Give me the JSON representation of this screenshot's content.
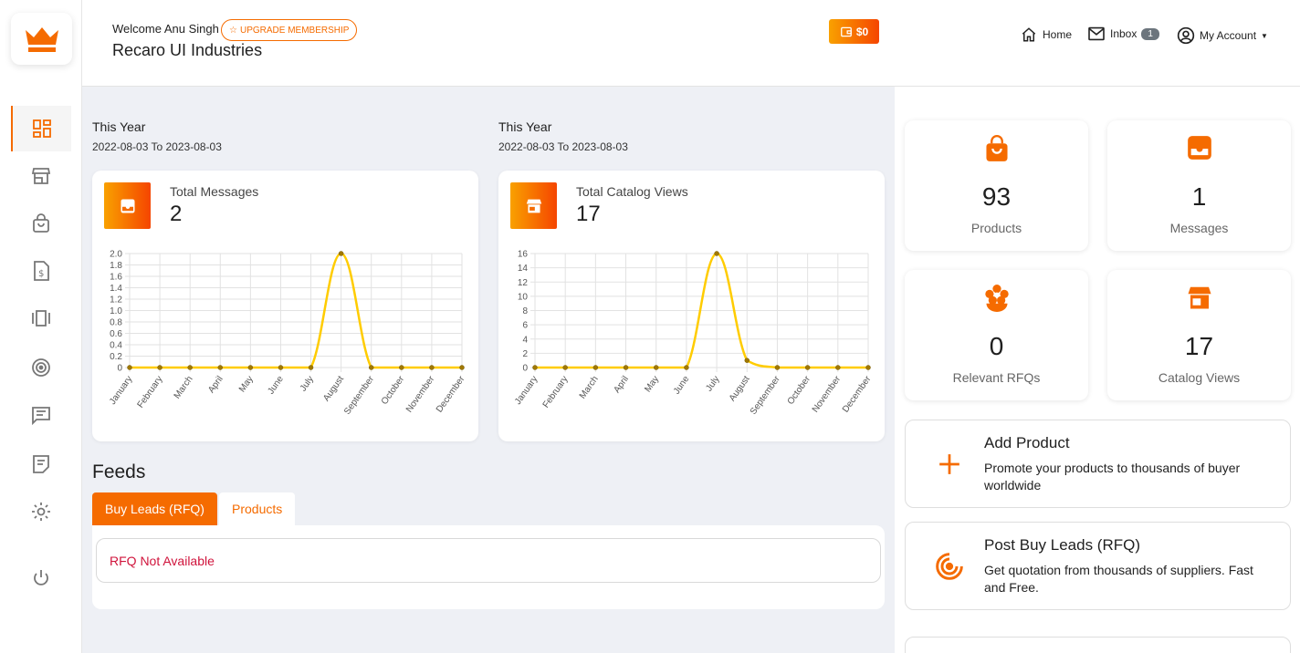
{
  "header": {
    "welcome": "Welcome Anu Singh",
    "upgrade_label": "UPGRADE MEMBERSHIP",
    "company": "Recaro UI Industries",
    "wallet": "$0",
    "home": "Home",
    "inbox": "Inbox",
    "inbox_count": "1",
    "account": "My Account"
  },
  "sidebar": {
    "items": [
      "dashboard-icon",
      "store-icon",
      "bag-icon",
      "invoice-icon",
      "carousel-icon",
      "target-icon",
      "chat-icon",
      "notes-icon",
      "gear-icon",
      "power-icon"
    ]
  },
  "periods": [
    {
      "title": "This Year",
      "range": "2022-08-03 To 2023-08-03"
    },
    {
      "title": "This Year",
      "range": "2022-08-03 To 2023-08-03"
    }
  ],
  "cards": [
    {
      "label": "Total Messages",
      "value": "2"
    },
    {
      "label": "Total Catalog Views",
      "value": "17"
    }
  ],
  "feeds": {
    "title": "Feeds",
    "tabs": [
      "Buy Leads (RFQ)",
      "Products"
    ],
    "empty_message": "RFQ Not Available"
  },
  "stats": [
    {
      "value": "93",
      "label": "Products",
      "icon": "bag-icon"
    },
    {
      "value": "1",
      "label": "Messages",
      "icon": "inbox-icon"
    },
    {
      "value": "0",
      "label": "Relevant RFQs",
      "icon": "flower-icon"
    },
    {
      "value": "17",
      "label": "Catalog Views",
      "icon": "store-icon"
    }
  ],
  "actions": [
    {
      "title": "Add Product",
      "desc": "Promote your products to thousands of buyer worldwide"
    },
    {
      "title": "Post Buy Leads (RFQ)",
      "desc": "Get quotation from thousands of suppliers. Fast and Free."
    }
  ],
  "colors": {
    "accent": "#f56b00",
    "line": "#ffcc00"
  },
  "chart_data": [
    {
      "type": "line",
      "categories": [
        "January",
        "February",
        "March",
        "April",
        "May",
        "June",
        "July",
        "August",
        "September",
        "October",
        "November",
        "December"
      ],
      "values": [
        0,
        0,
        0,
        0,
        0,
        0,
        0,
        2,
        0,
        0,
        0,
        0
      ],
      "yticks": [
        "0",
        "0.2",
        "0.4",
        "0.6",
        "0.8",
        "1.0",
        "1.2",
        "1.4",
        "1.6",
        "1.8",
        "2.0"
      ],
      "ylim": [
        0,
        2
      ],
      "grid": true
    },
    {
      "type": "line",
      "categories": [
        "January",
        "February",
        "March",
        "April",
        "May",
        "June",
        "July",
        "August",
        "September",
        "October",
        "November",
        "December"
      ],
      "values": [
        0,
        0,
        0,
        0,
        0,
        0,
        16,
        1,
        0,
        0,
        0,
        0
      ],
      "yticks": [
        "0",
        "2",
        "4",
        "6",
        "8",
        "10",
        "12",
        "14",
        "16"
      ],
      "ylim": [
        0,
        16
      ],
      "grid": true
    }
  ]
}
